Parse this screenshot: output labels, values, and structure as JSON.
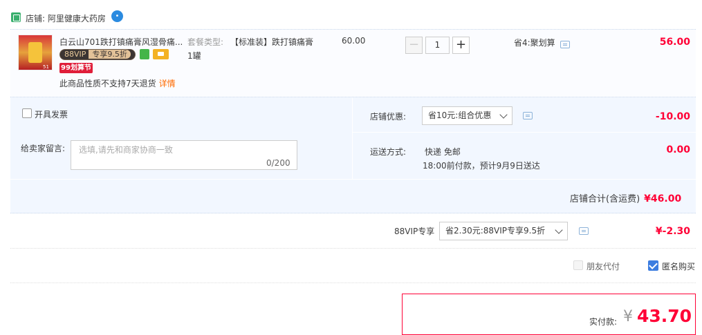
{
  "shop": {
    "label": "店铺: 阿里健康大药房",
    "chat_icon": "wangwang-chat-icon"
  },
  "item": {
    "title": "白云山701跌打镇痛膏风湿骨痛...",
    "vip_badge_left": "88VIP",
    "vip_badge_right": "专享9.5折",
    "tag_99": "99划算节",
    "no_return_text": "此商品性质不支持7天退货",
    "details_link": "详情",
    "thumb_tag": "51",
    "sku_label": "套餐类型:",
    "sku_value": "【标准装】跌打镇痛膏",
    "sku_qty": "1罐",
    "unit_price": "60.00",
    "quantity": "1",
    "minus": "−",
    "plus": "+",
    "promo": "省4:聚划算",
    "subtotal": "56.00"
  },
  "invoice": {
    "label": "开具发票"
  },
  "message": {
    "label": "给卖家留言:",
    "placeholder": "选填,请先和商家协商一致",
    "counter": "0/200"
  },
  "store_discount": {
    "label": "店铺优惠:",
    "selected": "省10元:组合优惠",
    "amount": "-10.00"
  },
  "shipping": {
    "label": "运送方式:",
    "value": "快递 免邮",
    "eta": "18:00前付款，预计9月9日送达",
    "amount": "0.00"
  },
  "store_total": {
    "label": "店铺合计(含运费)",
    "value": "¥46.00"
  },
  "vip_discount": {
    "label": "88VIP专享",
    "selected": "省2.30元:88VIP专享9.5折",
    "amount": "¥-2.30"
  },
  "friend_pay": {
    "label": "朋友代付",
    "checked": false
  },
  "anonymous": {
    "label": "匿名购买",
    "checked": true
  },
  "payment": {
    "label": "实付款:",
    "currency": "¥",
    "amount": "43.70"
  },
  "colors": {
    "accent_red": "#ff0036",
    "link_orange": "#ff6a00",
    "option_bg": "#f2f7ff",
    "checkbox_blue": "#3c7de0"
  }
}
